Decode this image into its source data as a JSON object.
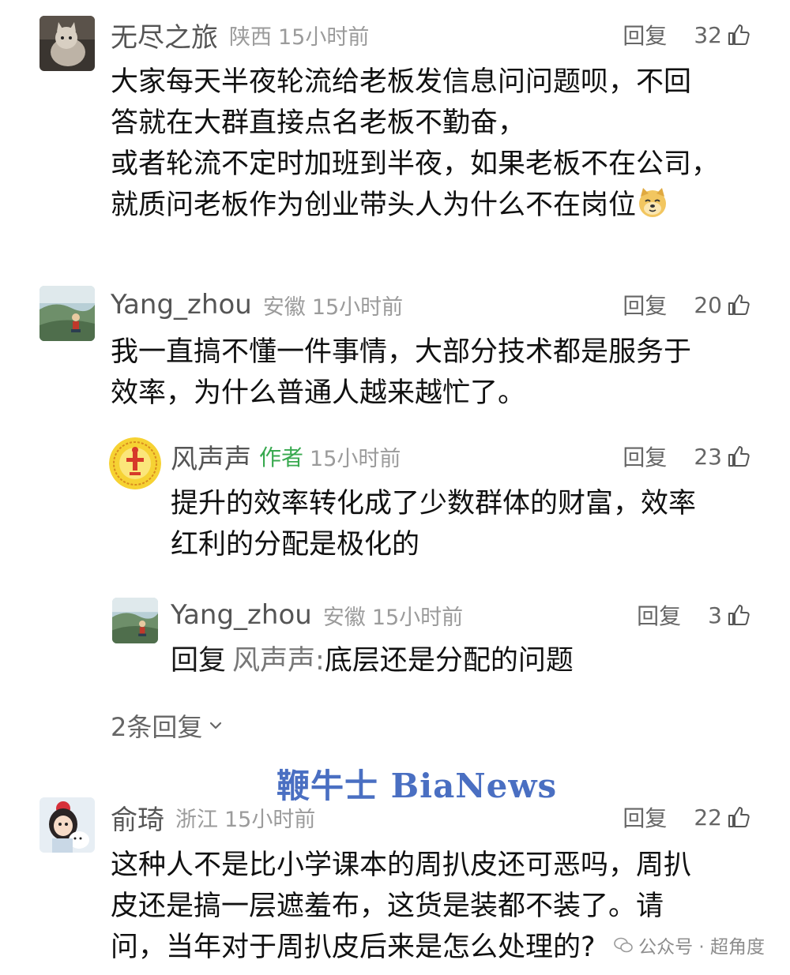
{
  "comments": [
    {
      "name": "无尽之旅",
      "location": "陕西",
      "time": "15小时前",
      "reply_label": "回复",
      "likes": "32",
      "lines": [
        "大家每天半夜轮流给老板发信息问问题呗，不回",
        "答就在大群直接点名老板不勤奋，",
        "或者轮流不定时加班到半夜，如果老板不在公司，",
        "就质问老板作为创业带头人为什么不在岗位"
      ],
      "emoji": "doge-emoji"
    },
    {
      "name": "Yang_zhou",
      "location": "安徽",
      "time": "15小时前",
      "reply_label": "回复",
      "likes": "20",
      "lines": [
        "我一直搞不懂一件事情，大部分技术都是服务于",
        "效率，为什么普通人越来越忙了。"
      ]
    }
  ],
  "replies": [
    {
      "name": "风声声",
      "author_tag": "作者",
      "time": "15小时前",
      "reply_label": "回复",
      "likes": "23",
      "lines": [
        "提升的效率转化成了少数群体的财富，效率",
        "红利的分配是极化的"
      ]
    },
    {
      "name": "Yang_zhou",
      "location": "安徽",
      "time": "15小时前",
      "reply_label": "回复",
      "likes": "3",
      "reply_prefix": "回复",
      "reply_target": "风声声:",
      "reply_text": "底层还是分配的问题"
    }
  ],
  "more_replies": "2条回复",
  "comment3": {
    "name": "俞琦",
    "location": "浙江",
    "time": "15小时前",
    "reply_label": "回复",
    "likes": "22",
    "lines": [
      "这种人不是比小学课本的周扒皮还可恶吗，周扒",
      "皮还是搞一层遮羞布，这货是装都不装了。请",
      "问，当年对于周扒皮后来是怎么处理的?"
    ]
  },
  "watermark": {
    "logo": "鞭牛士 BiaNews",
    "source": "公众号 · 超角度"
  },
  "colors": {
    "author_tag": "#38a94f",
    "meta_gray": "#9b9b9b",
    "watermark_blue": "#4a6fc2"
  },
  "icons": {
    "like": "thumbs-up-icon",
    "expand": "chevron-down-icon",
    "wechat": "wechat-icon"
  }
}
